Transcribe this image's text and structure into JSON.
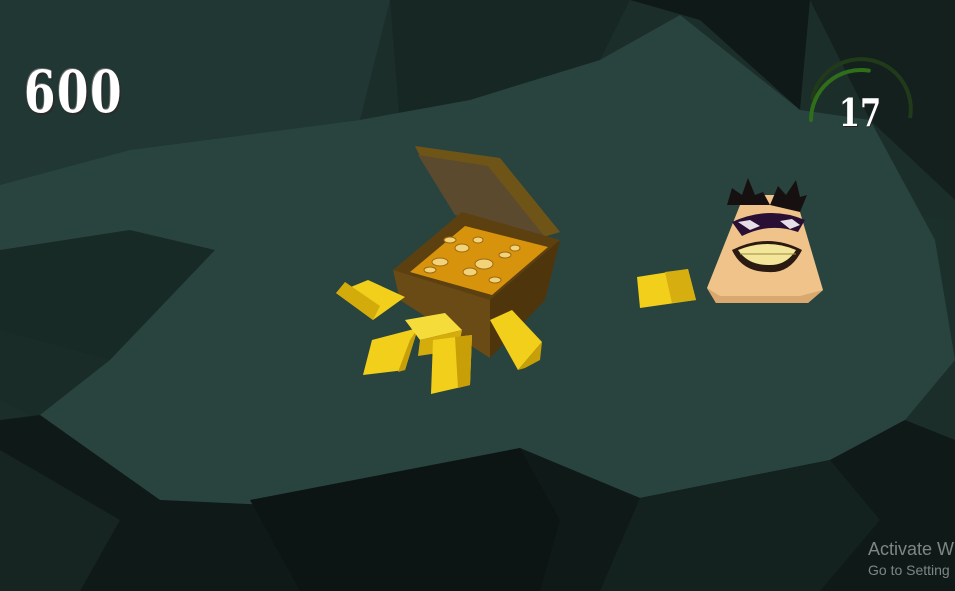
{
  "hud": {
    "score": "600",
    "timer": "17",
    "timer_progress": 0.55
  },
  "watermark": {
    "title": "Activate W",
    "subtitle": "Go to Setting"
  },
  "colors": {
    "cave_floor": "#29443e",
    "cave_dark": "#0f1a18",
    "gold": "#f1cf1b",
    "chest_wood": "#6a4b16",
    "timer_arc": "#2f6f1a"
  },
  "icons": [
    "treasure-chest-icon",
    "gold-bar-icon",
    "thief-face-icon",
    "timer-arc-icon"
  ]
}
